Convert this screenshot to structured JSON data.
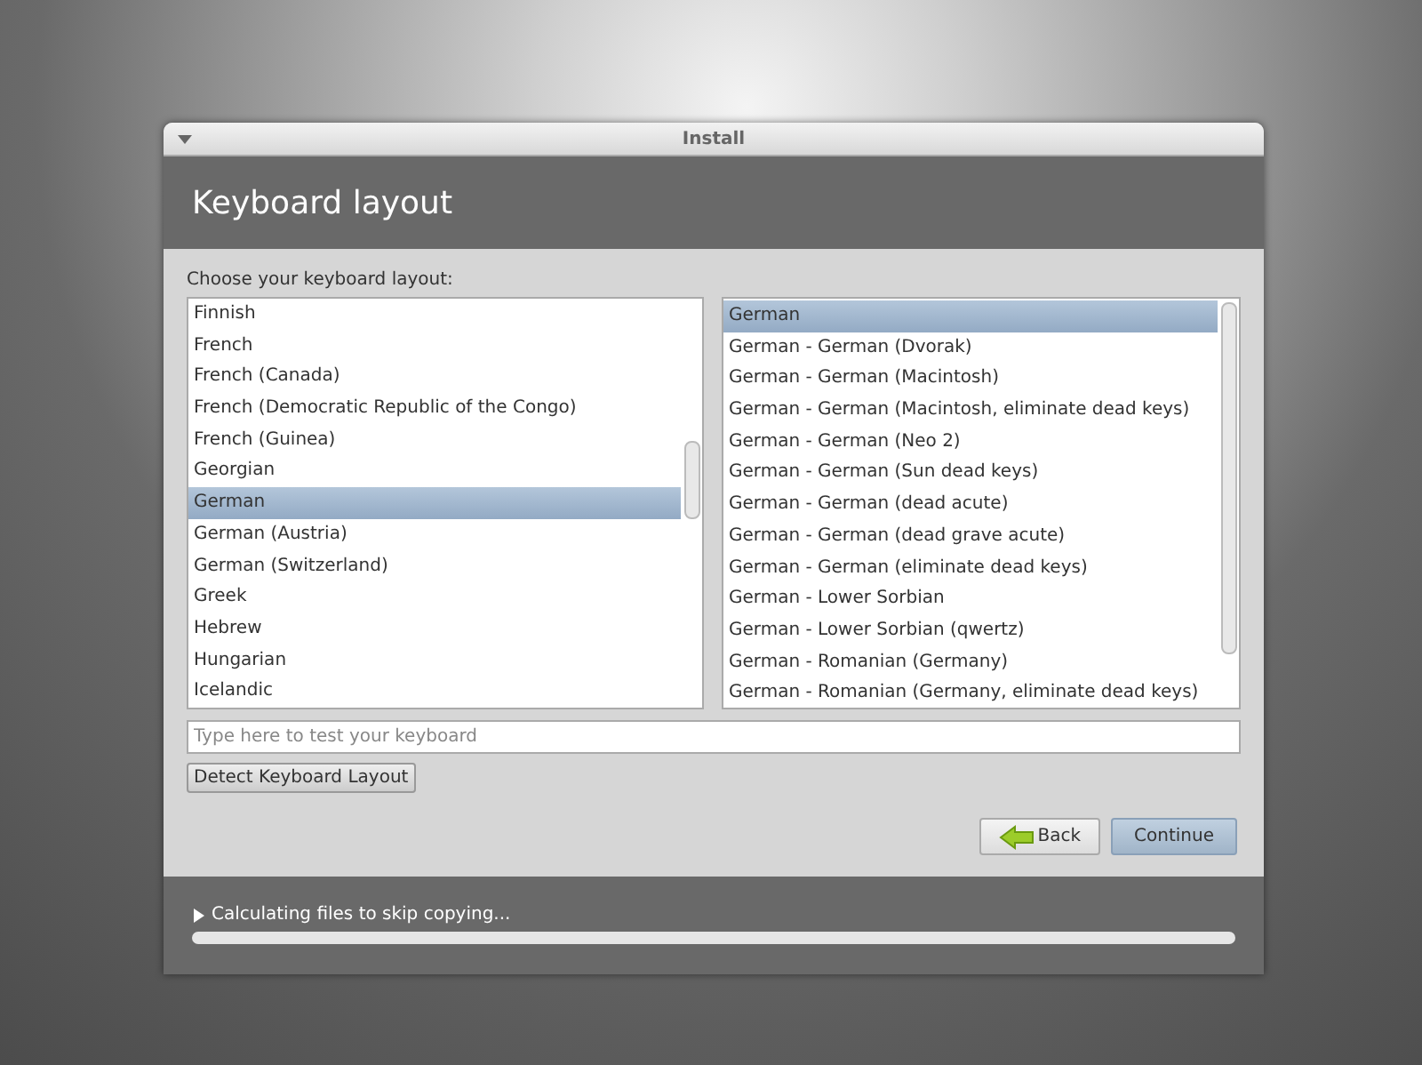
{
  "window": {
    "title": "Install"
  },
  "header": {
    "title": "Keyboard layout"
  },
  "prompt": "Choose your keyboard layout:",
  "layouts": [
    {
      "label": "Finnish",
      "selected": false
    },
    {
      "label": "French",
      "selected": false
    },
    {
      "label": "French (Canada)",
      "selected": false
    },
    {
      "label": "French (Democratic Republic of the Congo)",
      "selected": false
    },
    {
      "label": "French (Guinea)",
      "selected": false
    },
    {
      "label": "Georgian",
      "selected": false
    },
    {
      "label": "German",
      "selected": true
    },
    {
      "label": "German (Austria)",
      "selected": false
    },
    {
      "label": "German (Switzerland)",
      "selected": false
    },
    {
      "label": "Greek",
      "selected": false
    },
    {
      "label": "Hebrew",
      "selected": false
    },
    {
      "label": "Hungarian",
      "selected": false
    },
    {
      "label": "Icelandic",
      "selected": false
    }
  ],
  "variants": [
    {
      "label": "German",
      "selected": true
    },
    {
      "label": "German - German (Dvorak)",
      "selected": false
    },
    {
      "label": "German - German (Macintosh)",
      "selected": false
    },
    {
      "label": "German - German (Macintosh, eliminate dead keys)",
      "selected": false
    },
    {
      "label": "German - German (Neo 2)",
      "selected": false
    },
    {
      "label": "German - German (Sun dead keys)",
      "selected": false
    },
    {
      "label": "German - German (dead acute)",
      "selected": false
    },
    {
      "label": "German - German (dead grave acute)",
      "selected": false
    },
    {
      "label": "German - German (eliminate dead keys)",
      "selected": false
    },
    {
      "label": "German - Lower Sorbian",
      "selected": false
    },
    {
      "label": "German - Lower Sorbian (qwertz)",
      "selected": false
    },
    {
      "label": "German - Romanian (Germany)",
      "selected": false
    },
    {
      "label": "German - Romanian (Germany, eliminate dead keys)",
      "selected": false
    }
  ],
  "test_field": {
    "placeholder": "Type here to test your keyboard"
  },
  "detect_button": "Detect Keyboard Layout",
  "buttons": [
    {
      "kind": "back",
      "label": "Back"
    },
    {
      "kind": "continue",
      "label": "Continue"
    }
  ],
  "progress": {
    "label": "Calculating files to skip copying...",
    "expanded": false,
    "level": 0
  }
}
